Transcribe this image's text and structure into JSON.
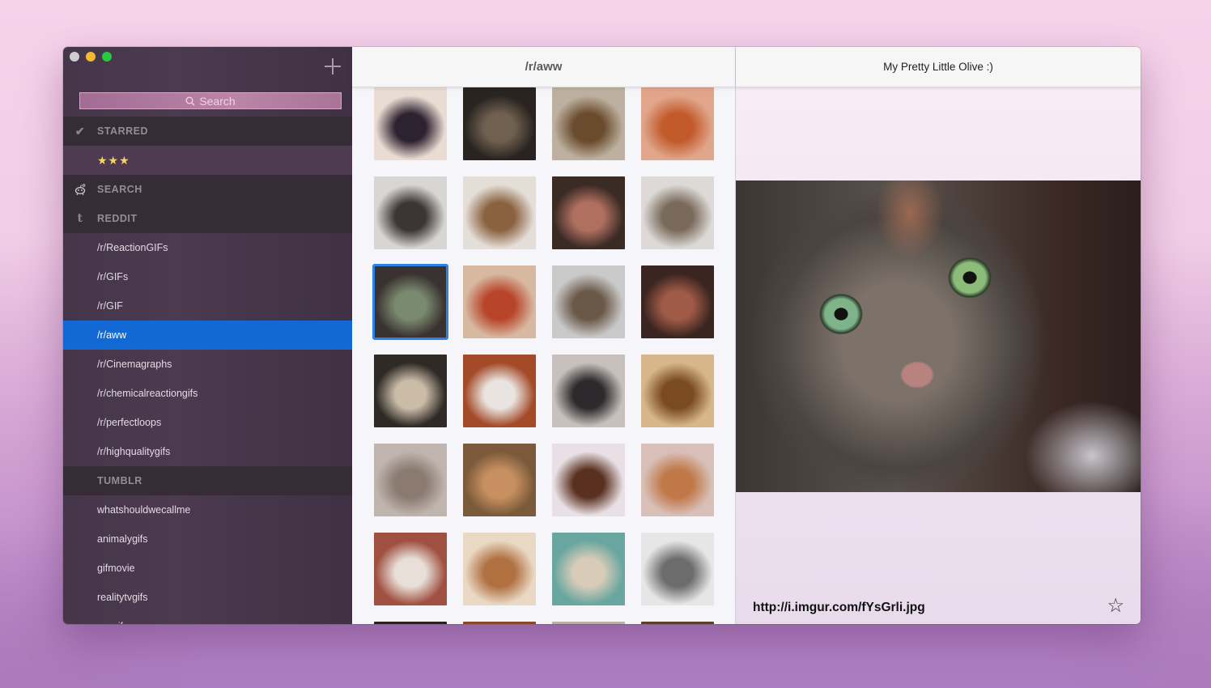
{
  "window": {
    "traffic_lights": [
      "close",
      "minimize",
      "maximize"
    ]
  },
  "sidebar": {
    "add_icon": "plus-icon",
    "search": {
      "placeholder": "Search",
      "icon": "magnifier-icon"
    },
    "sections": [
      {
        "id": "starred",
        "label": "STARRED",
        "icon": "checkmark-icon",
        "items": [
          {
            "label": "★★★",
            "kind": "stars"
          }
        ]
      },
      {
        "id": "search",
        "label": "SEARCH",
        "icon": "reddit-alien-icon",
        "items": []
      },
      {
        "id": "reddit",
        "label": "REDDIT",
        "icon": "tumblr-icon",
        "items": [
          {
            "label": "/r/ReactionGIFs"
          },
          {
            "label": "/r/GIFs"
          },
          {
            "label": "/r/GIF"
          },
          {
            "label": "/r/aww",
            "selected": true
          },
          {
            "label": "/r/Cinemagraphs"
          },
          {
            "label": "/r/chemicalreactiongifs"
          },
          {
            "label": "/r/perfectloops"
          },
          {
            "label": "/r/highqualitygifs"
          }
        ]
      },
      {
        "id": "tumblr",
        "label": "TUMBLR",
        "icon": "",
        "items": [
          {
            "label": "whatshouldwecallme"
          },
          {
            "label": "animalygifs"
          },
          {
            "label": "gifmovie"
          },
          {
            "label": "realitytvgifs"
          },
          {
            "label": "mr-gif"
          }
        ]
      }
    ]
  },
  "grid": {
    "title": "/r/aww",
    "selected_index": 8,
    "thumbnails": [
      {
        "desc": "two black kittens on floor",
        "c1": "#e9dcd3",
        "c2": "#2d2230"
      },
      {
        "desc": "tabby cat in dark",
        "c1": "#2a2420",
        "c2": "#6f6050"
      },
      {
        "desc": "kittens in boots",
        "c1": "#bdb0a0",
        "c2": "#6a4b2c"
      },
      {
        "desc": "hamster in blanket",
        "c1": "#e0a58a",
        "c2": "#c25a2b"
      },
      {
        "desc": "calico kitten on tile",
        "c1": "#d8d6d4",
        "c2": "#3c3535"
      },
      {
        "desc": "puppy in blanket",
        "c1": "#e4ded8",
        "c2": "#8a6240"
      },
      {
        "desc": "black and white cat",
        "c1": "#3a2b25",
        "c2": "#b07060"
      },
      {
        "desc": "kitten on bed",
        "c1": "#dcd9d6",
        "c2": "#7a6a5c"
      },
      {
        "desc": "tabby kitten close-up",
        "c1": "#3a3230",
        "c2": "#7a8a70"
      },
      {
        "desc": "beagle with red scarf",
        "c1": "#d7b8a0",
        "c2": "#b8442a"
      },
      {
        "desc": "puppy in fridge",
        "c1": "#c9c9c9",
        "c2": "#6a5848"
      },
      {
        "desc": "kitten on couch",
        "c1": "#3a2520",
        "c2": "#a05a48"
      },
      {
        "desc": "calico kitten lying",
        "c1": "#2f2a25",
        "c2": "#cbbca8"
      },
      {
        "desc": "two puppies on floor",
        "c1": "#a44a28",
        "c2": "#e9e4e0"
      },
      {
        "desc": "black cats sleeping",
        "c1": "#c8c0bc",
        "c2": "#2c2a2c"
      },
      {
        "desc": "kitten at window",
        "c1": "#d7b68c",
        "c2": "#7a4a20"
      },
      {
        "desc": "kitten in sink",
        "c1": "#bfb4ae",
        "c2": "#8a7a70"
      },
      {
        "desc": "golden puppy with bandana",
        "c1": "#7a5a3a",
        "c2": "#c89060"
      },
      {
        "desc": "puppy with bow tie",
        "c1": "#e8e0e4",
        "c2": "#5a3020"
      },
      {
        "desc": "orange kitten face",
        "c1": "#d8c0b8",
        "c2": "#c07848"
      },
      {
        "desc": "cat lying on blanket",
        "c1": "#a05040",
        "c2": "#e8e0d8"
      },
      {
        "desc": "golden retriever puppy",
        "c1": "#e9d8c4",
        "c2": "#b07040"
      },
      {
        "desc": "puppy at pool",
        "c1": "#6aa6a0",
        "c2": "#d8ccb8"
      },
      {
        "desc": "two grey kittens",
        "c1": "#e6e6e6",
        "c2": "#6c6c6c"
      },
      {
        "desc": "partial thumbnail",
        "c1": "#2a2020",
        "c2": "#1a1515"
      },
      {
        "desc": "partial thumbnail",
        "c1": "#8a4a2a",
        "c2": "#6a3020"
      },
      {
        "desc": "partial thumbnail",
        "c1": "#bab0aa",
        "c2": "#9a8a84"
      },
      {
        "desc": "partial thumbnail",
        "c1": "#5a4028",
        "c2": "#3a2818"
      }
    ]
  },
  "detail": {
    "title": "My Pretty Little Olive :)",
    "image_desc": "Close-up of a tabby cat with green eyes",
    "url": "http://i.imgur.com/fYsGrli.jpg",
    "star_icon": "star-outline-icon"
  },
  "colors": {
    "selection": "#1269d3",
    "thumb_selection": "#2d84e4",
    "stars": "#f7d55a"
  }
}
